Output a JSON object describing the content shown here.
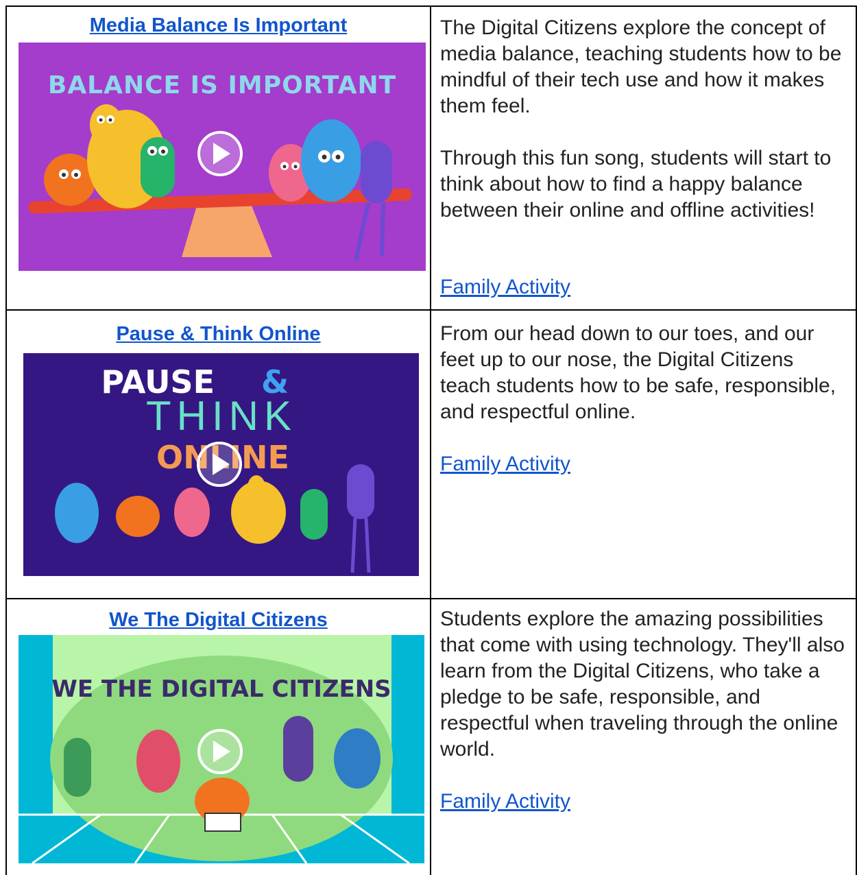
{
  "rows": [
    {
      "title": "Media Balance Is Important",
      "thumbnail_text": "BALANCE IS IMPORTANT",
      "paragraphs": [
        "The Digital Citizens explore the concept of media balance, teaching students how to be mindful of their tech use and how it makes them feel.",
        "Through this fun song, students will start to think about how to find a happy balance between their online and offline activities!"
      ],
      "activity_link": "Family Activity"
    },
    {
      "title": "Pause & Think Online",
      "thumbnail_text": [
        "PAUSE",
        "&",
        "THINK",
        "ONLINE"
      ],
      "paragraphs": [
        "From our head down to our toes, and our feet up to our nose, the Digital Citizens teach students how to be safe, responsible, and respectful online."
      ],
      "activity_link": "Family Activity"
    },
    {
      "title": "We The Digital Citizens",
      "thumbnail_text": "WE THE DIGITAL CITIZENS",
      "paragraphs": [
        "Students explore the amazing possibilities that come with using technology. They'll also learn from the Digital Citizens, who take a pledge to be safe, responsible, and respectful when traveling through the online world."
      ],
      "activity_link": "Family Activity"
    }
  ],
  "icons": {
    "play": "play-button-icon"
  },
  "colors": {
    "link": "#1155cc",
    "thumb1_bg": "#a43ccc",
    "thumb2_bg": "#351783",
    "thumb3_bg": "#00b7d6"
  }
}
